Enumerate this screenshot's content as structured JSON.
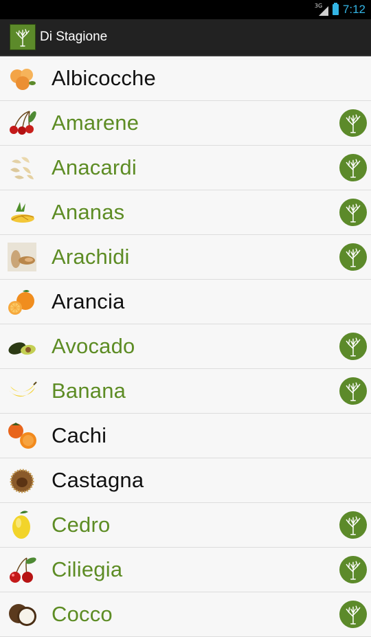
{
  "status": {
    "network": "3G",
    "time": "7:12"
  },
  "app": {
    "title": "Di Stagione",
    "icon": "tree-icon"
  },
  "colors": {
    "seasonal_text": "#5d8c24",
    "normal_text": "#111111",
    "badge": "#5c8a2a"
  },
  "items": [
    {
      "label": "Albicocche",
      "icon": "apricot-icon",
      "in_season": false
    },
    {
      "label": "Amarene",
      "icon": "sour-cherry-icon",
      "in_season": true
    },
    {
      "label": "Anacardi",
      "icon": "cashew-icon",
      "in_season": true
    },
    {
      "label": "Ananas",
      "icon": "pineapple-icon",
      "in_season": true
    },
    {
      "label": "Arachidi",
      "icon": "peanut-icon",
      "in_season": true
    },
    {
      "label": "Arancia",
      "icon": "orange-icon",
      "in_season": false
    },
    {
      "label": "Avocado",
      "icon": "avocado-icon",
      "in_season": true
    },
    {
      "label": "Banana",
      "icon": "banana-icon",
      "in_season": true
    },
    {
      "label": "Cachi",
      "icon": "persimmon-icon",
      "in_season": false
    },
    {
      "label": "Castagna",
      "icon": "chestnut-icon",
      "in_season": false
    },
    {
      "label": "Cedro",
      "icon": "citron-icon",
      "in_season": true
    },
    {
      "label": "Ciliegia",
      "icon": "cherry-icon",
      "in_season": true
    },
    {
      "label": "Cocco",
      "icon": "coconut-icon",
      "in_season": true
    }
  ]
}
